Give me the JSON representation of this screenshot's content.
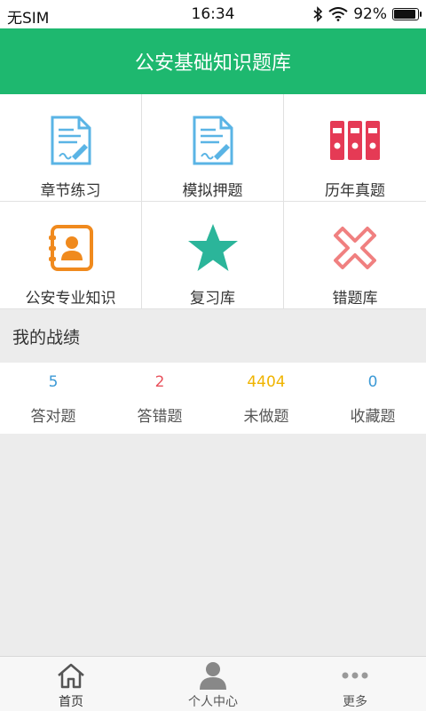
{
  "status_bar": {
    "carrier": "无SIM",
    "time": "16:34",
    "battery_text": "92%",
    "battery_level": 0.92
  },
  "header": {
    "title": "公安基础知识题库"
  },
  "menu": {
    "items": [
      {
        "label": "章节练习",
        "icon": "document-pen-icon",
        "color": "#5ab4e5"
      },
      {
        "label": "模拟押题",
        "icon": "document-pen-icon",
        "color": "#5ab4e5"
      },
      {
        "label": "历年真题",
        "icon": "binders-icon",
        "color": "#e53a55"
      },
      {
        "label": "公安专业知识",
        "icon": "contact-book-icon",
        "color": "#f08a1e"
      },
      {
        "label": "复习库",
        "icon": "star-icon",
        "color": "#2bb59a"
      },
      {
        "label": "错题库",
        "icon": "cross-icon",
        "color": "#f08080"
      }
    ]
  },
  "stats_section": {
    "title": "我的战绩",
    "items": [
      {
        "value": "5",
        "label": "答对题",
        "color": "#3d9ad6"
      },
      {
        "value": "2",
        "label": "答错题",
        "color": "#e8505b"
      },
      {
        "value": "4404",
        "label": "未做题",
        "color": "#f0b400"
      },
      {
        "value": "0",
        "label": "收藏题",
        "color": "#3d9ad6"
      }
    ]
  },
  "tab_bar": {
    "tabs": [
      {
        "label": "首页",
        "icon": "home-icon"
      },
      {
        "label": "个人中心",
        "icon": "person-icon"
      },
      {
        "label": "更多",
        "icon": "more-icon"
      }
    ]
  }
}
